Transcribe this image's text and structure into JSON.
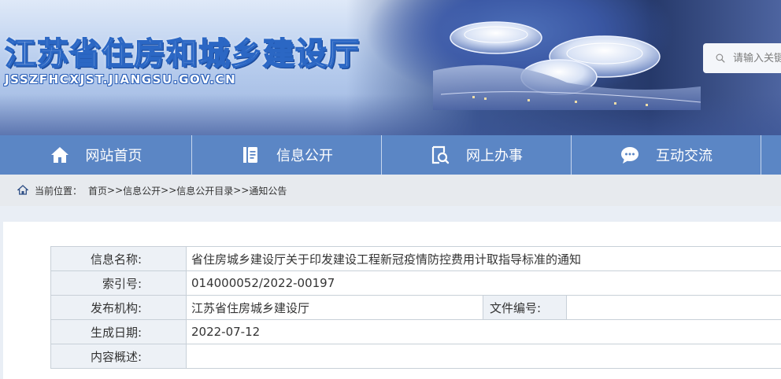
{
  "header": {
    "site_title": "江苏省住房和城乡建设厅",
    "site_url": "JSSZFHCXJST.JIANGSU.GOV.CN",
    "search_placeholder": "请输入关键字"
  },
  "nav": {
    "items": [
      {
        "label": "网站首页",
        "icon": "home-icon"
      },
      {
        "label": "信息公开",
        "icon": "document-icon"
      },
      {
        "label": "网上办事",
        "icon": "search-document-icon"
      },
      {
        "label": "互动交流",
        "icon": "chat-bubble-icon"
      }
    ]
  },
  "breadcrumb": {
    "label": "当前位置：",
    "items": [
      "首页",
      "信息公开",
      "信息公开目录",
      "通知公告"
    ],
    "separator": ">>"
  },
  "info_table": {
    "rows": [
      {
        "label": "信息名称:",
        "value": "省住房城乡建设厅关于印发建设工程新冠疫情防控费用计取指导标准的通知"
      },
      {
        "label": "索引号:",
        "value": "014000052/2022-00197"
      },
      {
        "label": "发布机构:",
        "value": "江苏省住房城乡建设厅",
        "extra_label": "文件编号:",
        "extra_value": ""
      },
      {
        "label": "生成日期:",
        "value": "2022-07-12"
      },
      {
        "label": "内容概述:",
        "value": ""
      }
    ]
  },
  "colors": {
    "nav_bg": "#5b86c5",
    "title_blue": "#2b67c4",
    "table_key_bg": "#edf1f6"
  }
}
